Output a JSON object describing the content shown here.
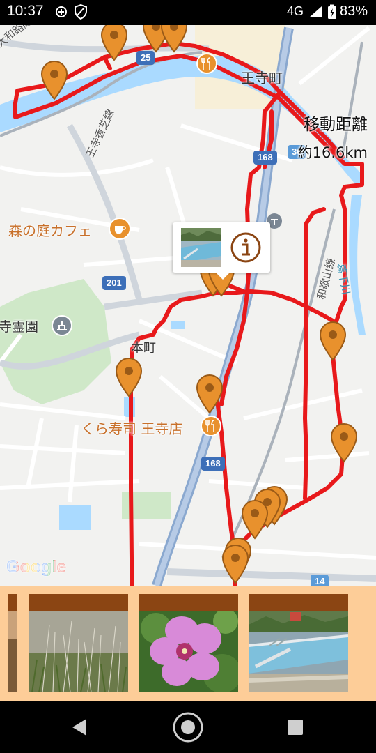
{
  "status_bar": {
    "time": "10:37",
    "network": "4G",
    "battery": "83%",
    "icons": [
      "data-saver-icon",
      "shield-icon",
      "signal-icon",
      "battery-charging-icon"
    ]
  },
  "map": {
    "distance": {
      "title": "移動距離",
      "value": "約16.6km"
    },
    "places": {
      "town_1": "王寺町",
      "town_2": "本町",
      "cafe": "森の庭カフェ",
      "sushi": "くら寿司 王寺店",
      "cemetery": "寺霊園",
      "line_1": "大和路線",
      "line_2": "王寺香芝線",
      "line_3": "和歌山線",
      "river": "葛下川"
    },
    "road_shields": {
      "r25": "25",
      "r168a": "168",
      "r36": "36",
      "r201": "201",
      "r168b": "168",
      "r14": "14"
    },
    "attribution": "Google",
    "route_color": "#e8191b",
    "marker_color": "#e8912d",
    "popup": {
      "thumbnail": "pool-photo",
      "info_icon": "info-icon"
    }
  },
  "photo_strip": {
    "background": "#fdcd98",
    "items": [
      {
        "name": "photo-partial",
        "subject": "partial"
      },
      {
        "name": "photo-grass",
        "subject": "grass"
      },
      {
        "name": "photo-hibiscus",
        "subject": "hibiscus"
      },
      {
        "name": "photo-pool",
        "subject": "pool"
      }
    ]
  },
  "nav_bar": {
    "back": "back-icon",
    "home": "home-icon",
    "recents": "recents-icon"
  }
}
